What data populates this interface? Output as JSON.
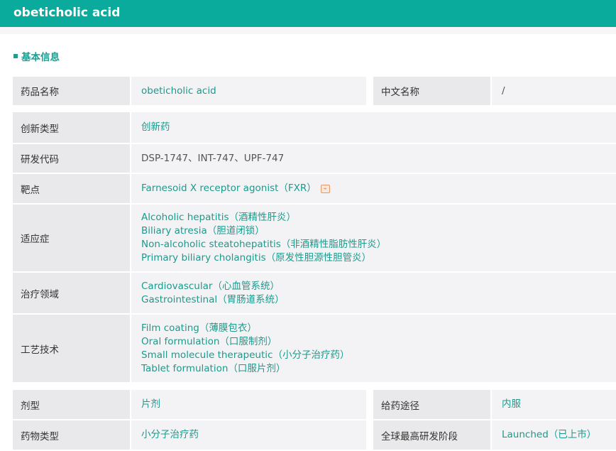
{
  "header": {
    "title": "obeticholic acid"
  },
  "section": {
    "title": "基本信息"
  },
  "top": {
    "drug_name_label": "药品名称",
    "drug_name": "obeticholic acid",
    "cn_name_label": "中文名称",
    "cn_name": "/"
  },
  "rows": {
    "innovation": {
      "label": "创新类型",
      "value": "创新药"
    },
    "codes": {
      "label": "研发代码",
      "value": "DSP-1747、INT-747、UPF-747"
    },
    "target": {
      "label": "靶点",
      "value": "Farnesoid X receptor agonist（FXR）"
    },
    "indications": {
      "label": "适应症",
      "items": [
        "Alcoholic hepatitis（酒精性肝炎）",
        "Biliary atresia（胆道闭锁）",
        "Non-alcoholic steatohepatitis（非酒精性脂肪性肝炎）",
        "Primary biliary cholangitis（原发性胆源性胆管炎）"
      ]
    },
    "areas": {
      "label": "治疗领域",
      "items": [
        "Cardiovascular（心血管系统）",
        "Gastrointestinal（胃肠道系统）"
      ]
    },
    "tech": {
      "label": "工艺技术",
      "items": [
        "Film coating（薄膜包衣）",
        "Oral formulation（口服制剂）",
        "Small molecule therapeutic（小分子治疗药）",
        "Tablet formulation（口服片剂）"
      ]
    }
  },
  "bottom": {
    "form_label": "剂型",
    "form": "片剂",
    "route_label": "给药途径",
    "route": "内服",
    "type_label": "药物类型",
    "type": "小分子治疗药",
    "stage_label": "全球最高研发阶段",
    "stage": "Launched（已上市）"
  },
  "colors": {
    "brand": "#0aaa9d",
    "value_text": "#1b9a8c"
  }
}
